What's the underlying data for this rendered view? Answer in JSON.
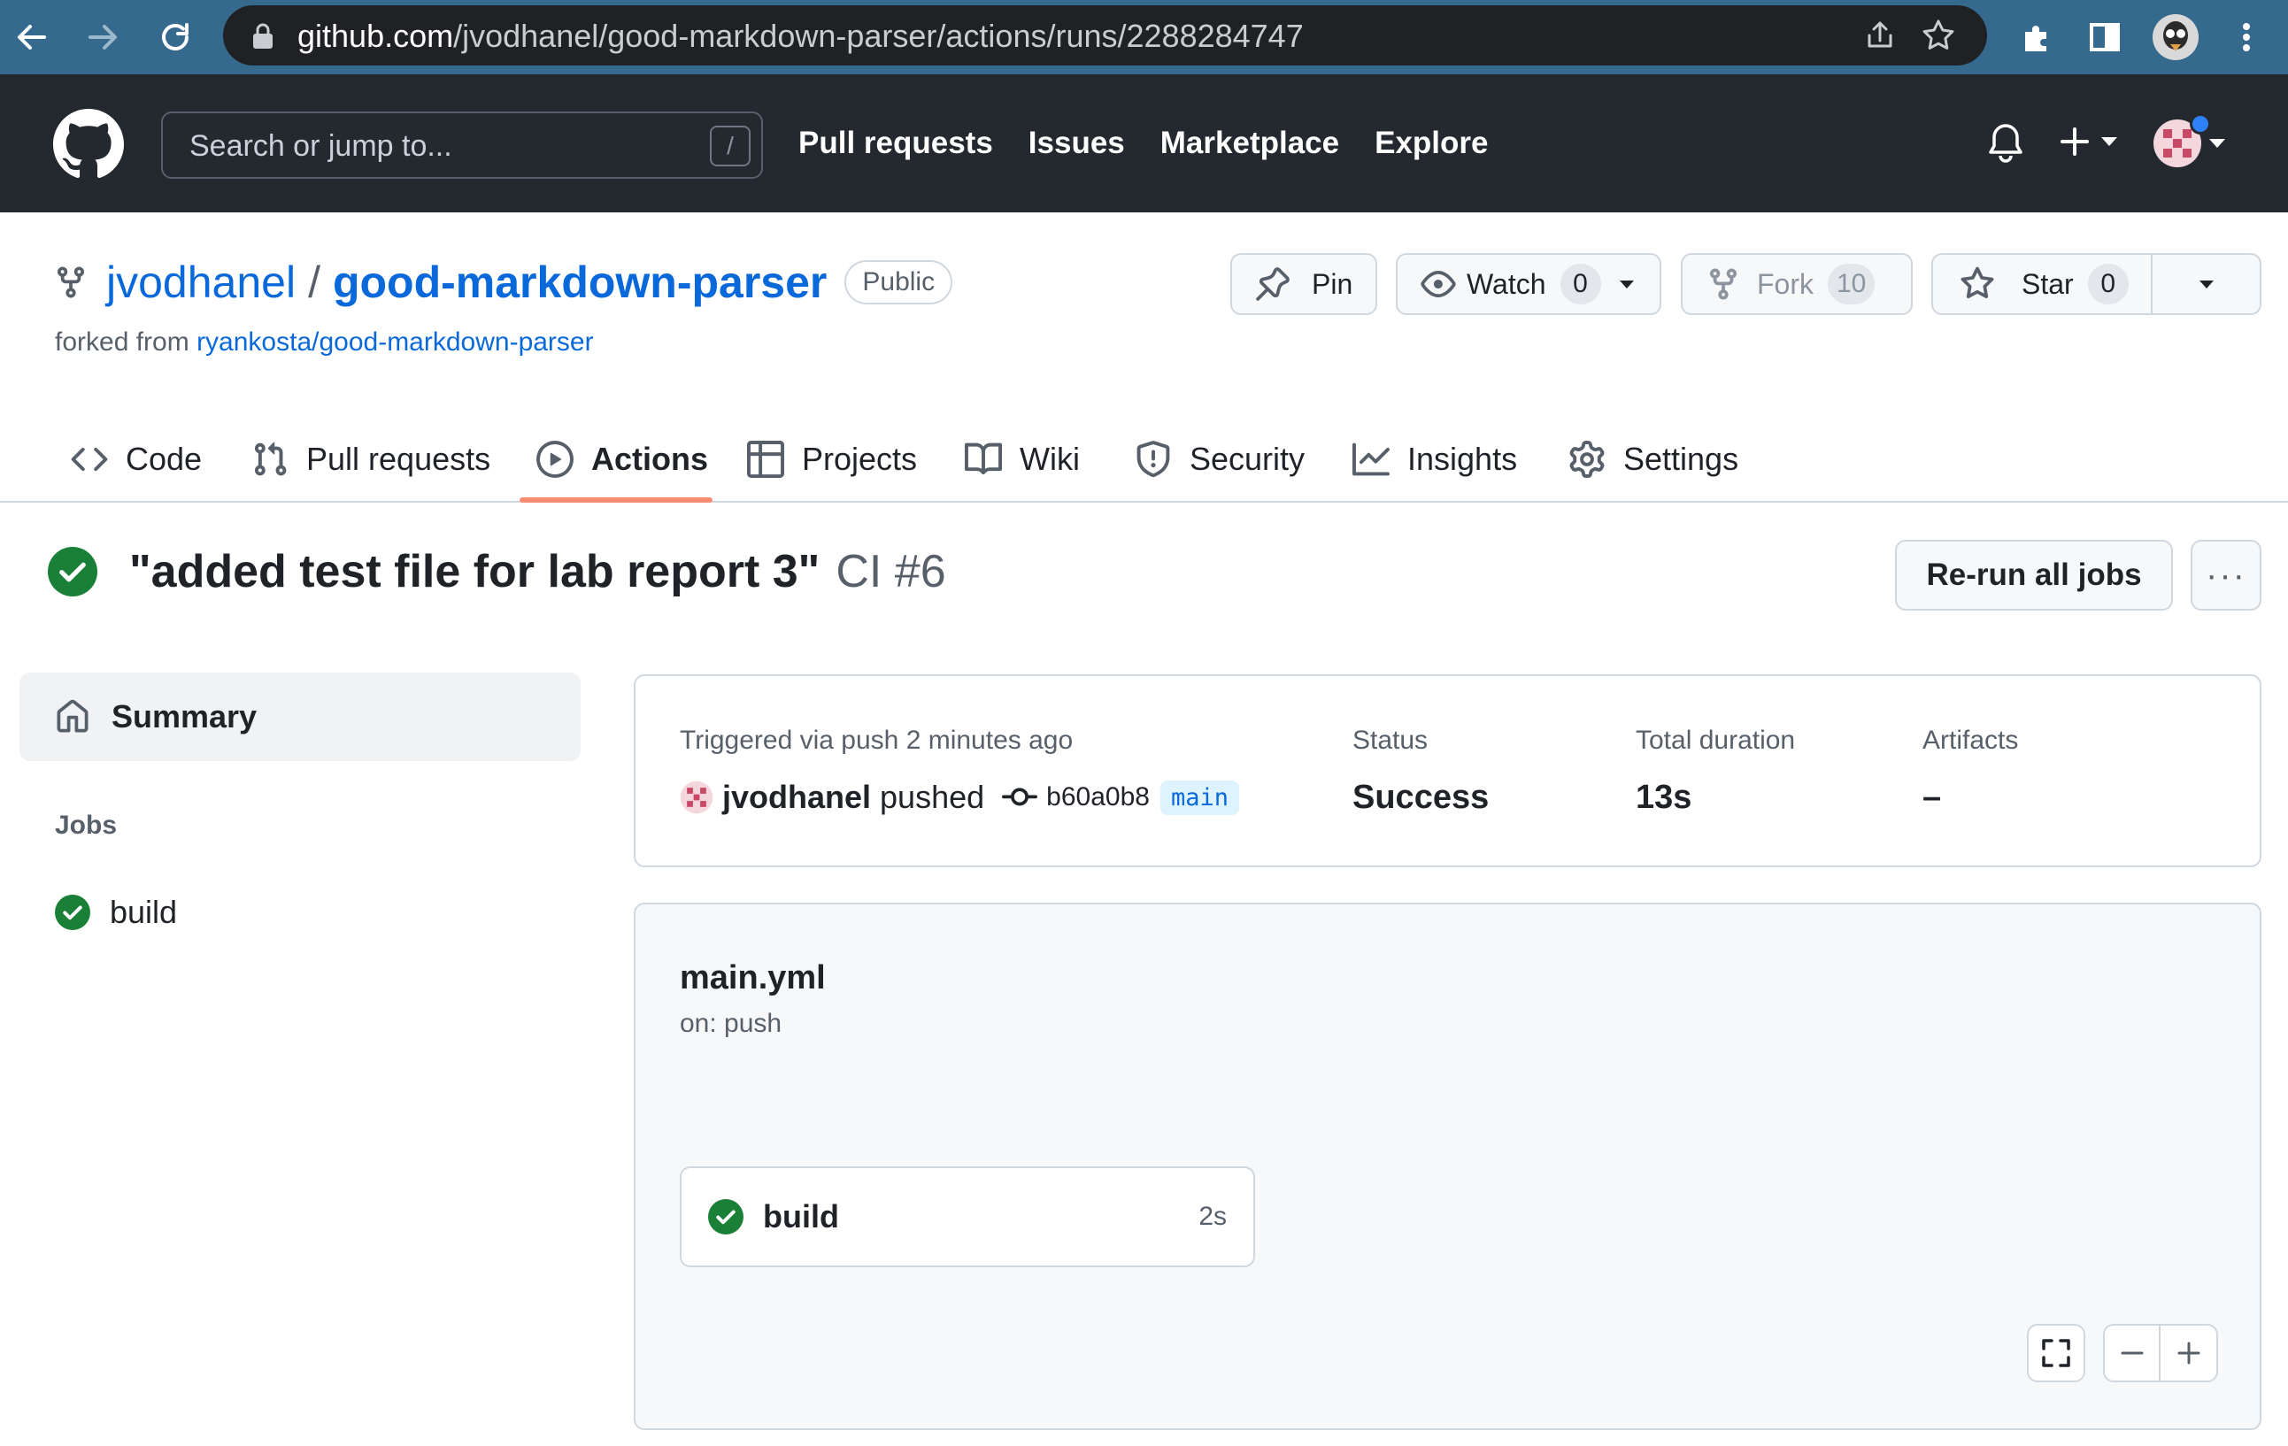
{
  "browser": {
    "url_host": "github.com",
    "url_path": "/jvodhanel/good-markdown-parser/actions/runs/2288284747"
  },
  "header": {
    "search_placeholder": "Search or jump to...",
    "search_shortcut": "/",
    "nav": [
      "Pull requests",
      "Issues",
      "Marketplace",
      "Explore"
    ]
  },
  "repo": {
    "owner": "jvodhanel",
    "separator": "/",
    "name": "good-markdown-parser",
    "visibility": "Public",
    "forked_from_label": "forked from",
    "forked_from": "ryankosta/good-markdown-parser",
    "buttons": {
      "pin": "Pin",
      "watch": "Watch",
      "watch_count": "0",
      "fork": "Fork",
      "fork_count": "10",
      "star": "Star",
      "star_count": "0"
    },
    "tabs": [
      "Code",
      "Pull requests",
      "Actions",
      "Projects",
      "Wiki",
      "Security",
      "Insights",
      "Settings"
    ],
    "selected_tab": "Actions"
  },
  "run": {
    "title": "\"added test file for lab report 3\"",
    "workflow_label": "CI #6",
    "rerun_label": "Re-run all jobs",
    "more_label": "···"
  },
  "sidebar": {
    "summary_label": "Summary",
    "jobs_heading": "Jobs",
    "jobs": [
      {
        "name": "build",
        "status": "success"
      }
    ]
  },
  "summary": {
    "trigger_text": "Triggered via push 2 minutes ago",
    "actor": "jvodhanel",
    "verb": "pushed",
    "commit_sha": "b60a0b8",
    "branch": "main",
    "status_label": "Status",
    "status_value": "Success",
    "duration_label": "Total duration",
    "duration_value": "13s",
    "artifacts_label": "Artifacts",
    "artifacts_value": "–"
  },
  "workflow": {
    "file": "main.yml",
    "trigger": "on: push",
    "job_name": "build",
    "job_duration": "2s"
  },
  "colors": {
    "success": "#1a7f37",
    "link": "#0969da",
    "tab_underline": "#fd8c73",
    "header_bg": "#24292f",
    "browser_bg": "#35698d"
  }
}
